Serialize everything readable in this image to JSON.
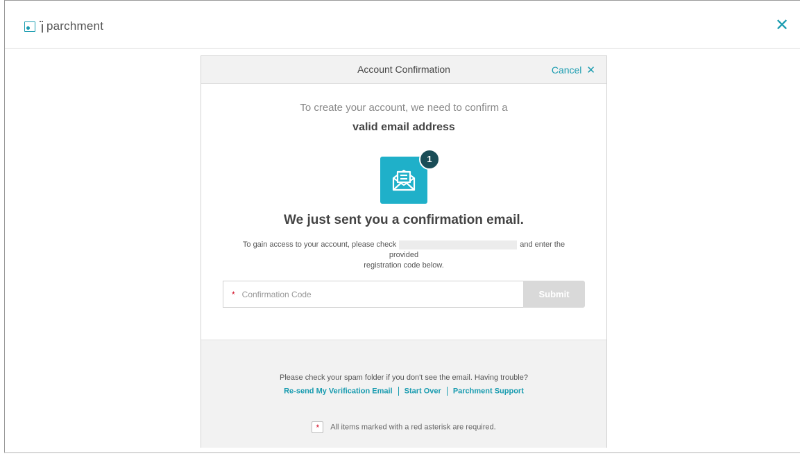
{
  "app": {
    "brand": "parchment"
  },
  "modal": {
    "title": "Account Confirmation",
    "cancel_label": "Cancel",
    "intro_line1": "To create your account, we need to confirm a",
    "intro_line2": "valid email address",
    "badge_count": "1",
    "sent_heading": "We just sent you a confirmation email.",
    "instructions_before": "To gain access to your account, please check",
    "instructions_after": "and enter the provided",
    "instructions_line2": "registration code below."
  },
  "form": {
    "required_marker": "*",
    "code_placeholder": "Confirmation Code",
    "code_value": "",
    "submit_label": "Submit"
  },
  "footer": {
    "spam_note": "Please check your spam folder if you don't see the email. Having trouble?",
    "links": [
      "Re-send My Verification Email",
      "Start Over",
      "Parchment Support"
    ],
    "required_marker": "*",
    "required_note": "All items marked with a red asterisk are required."
  },
  "icons": {
    "logo": "parchment-logo",
    "close": "close-icon",
    "cancel": "close-icon",
    "email": "open-envelope-icon"
  },
  "colors": {
    "accent": "#1a9cb0",
    "envelope_bg": "#1fb0c9",
    "badge_bg": "#1a4d57",
    "required": "#d0021b",
    "submit_disabled": "#d9d9d9"
  }
}
